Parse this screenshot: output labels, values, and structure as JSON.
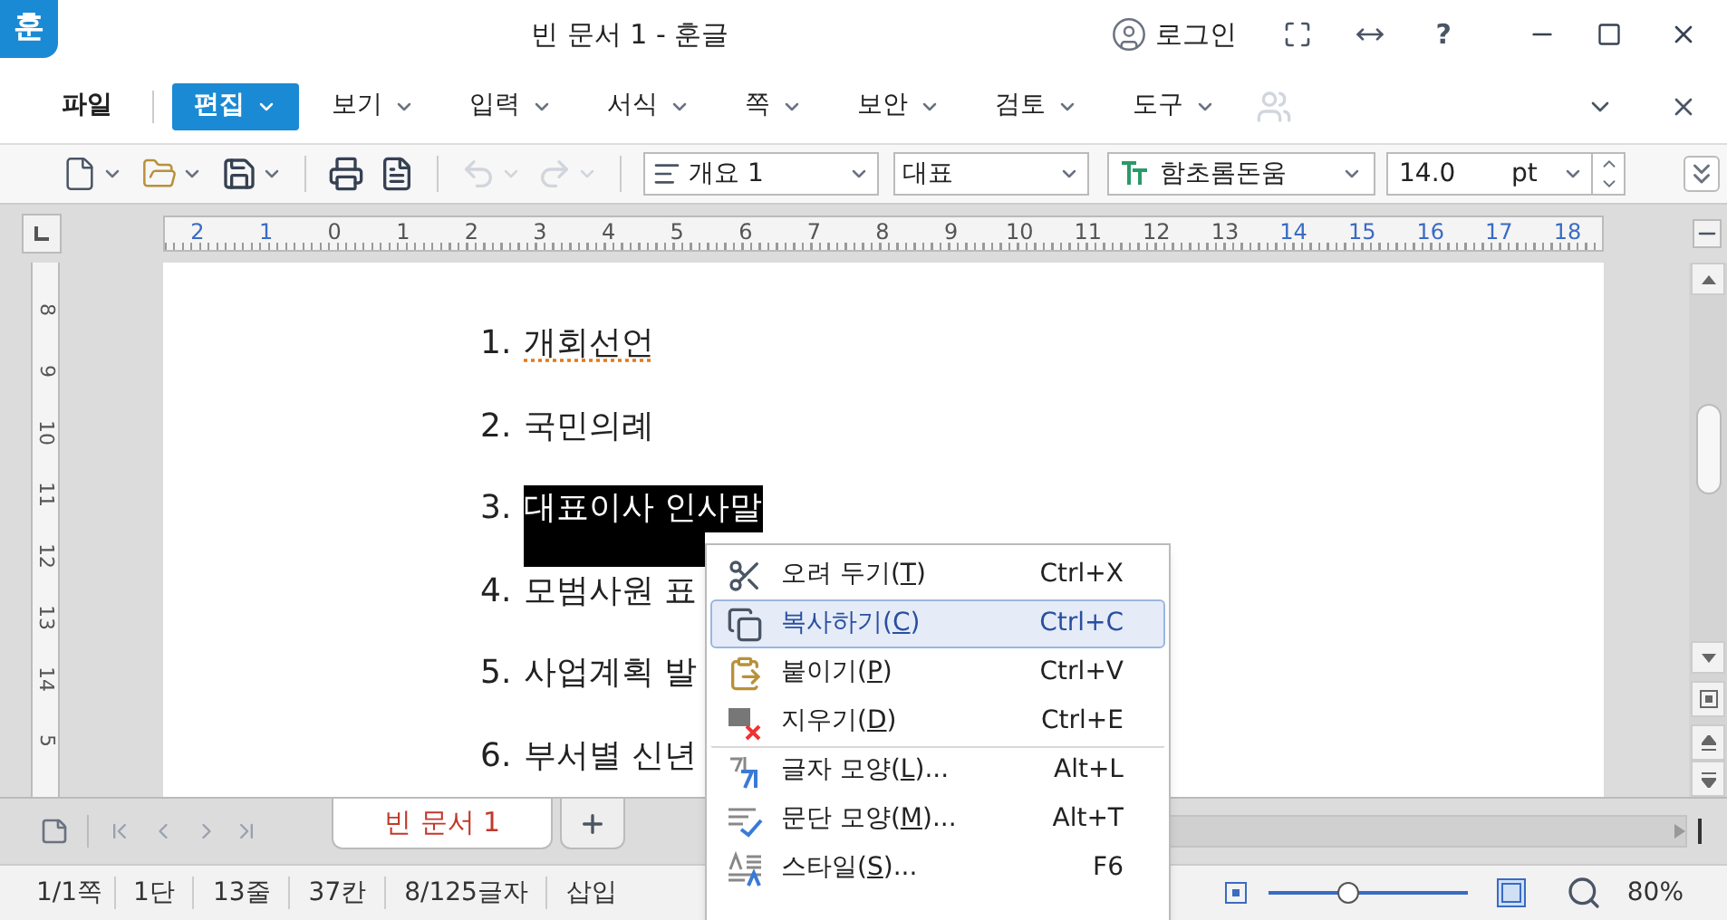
{
  "title_bar": {
    "logo": "훈",
    "title": "빈 문서 1 - 훈글",
    "login": "로그인",
    "help": "?"
  },
  "menu_bar": {
    "items": [
      {
        "label": "파일",
        "selected": false,
        "dropdown": false
      },
      {
        "label": "편집",
        "selected": true,
        "dropdown": true
      },
      {
        "label": "보기",
        "selected": false,
        "dropdown": true
      },
      {
        "label": "입력",
        "selected": false,
        "dropdown": true
      },
      {
        "label": "서식",
        "selected": false,
        "dropdown": true
      },
      {
        "label": "쪽",
        "selected": false,
        "dropdown": true
      },
      {
        "label": "보안",
        "selected": false,
        "dropdown": true
      },
      {
        "label": "검토",
        "selected": false,
        "dropdown": true
      },
      {
        "label": "도구",
        "selected": false,
        "dropdown": true
      }
    ]
  },
  "toolbar": {
    "undo_disabled": true,
    "redo_disabled": true,
    "style": "개요 1",
    "style_group": "대표",
    "font": "함초롬돈움",
    "size": "14.0",
    "unit": "pt"
  },
  "ruler": {
    "h_labels": [
      "2",
      "1",
      "0",
      "1",
      "2",
      "3",
      "4",
      "5",
      "6",
      "7",
      "8",
      "9",
      "10",
      "11",
      "12",
      "13",
      "14",
      "15",
      "16",
      "17",
      "18"
    ],
    "v_labels": [
      "8",
      "9",
      "10",
      "11",
      "12",
      "13",
      "14",
      "5"
    ]
  },
  "document": {
    "lines": [
      {
        "number": "1.",
        "text": "개회선언",
        "selected": false,
        "spell_error": true
      },
      {
        "number": "2.",
        "text": "국민의례",
        "selected": false,
        "spell_error": false
      },
      {
        "number": "3.",
        "text": "대표이사 인사말",
        "selected": true,
        "spell_error": false
      },
      {
        "number": "4.",
        "text": "모범사원 표",
        "selected": false,
        "spell_error": false
      },
      {
        "number": "5.",
        "text": "사업계획 발",
        "selected": false,
        "spell_error": false
      },
      {
        "number": "6.",
        "text": "부서별 신년",
        "selected": false,
        "spell_error": false
      }
    ]
  },
  "context_menu": {
    "items": [
      {
        "kind": "cut",
        "label": "오려 두기(",
        "key": "T",
        "label_end": ")",
        "shortcut": "Ctrl+X",
        "selected": false,
        "separator_before": false
      },
      {
        "kind": "copy",
        "label": "복사하기(",
        "key": "C",
        "label_end": ")",
        "shortcut": "Ctrl+C",
        "selected": true,
        "separator_before": false
      },
      {
        "kind": "paste",
        "label": "붙이기(",
        "key": "P",
        "label_end": ")",
        "shortcut": "Ctrl+V",
        "selected": false,
        "separator_before": false
      },
      {
        "kind": "delete",
        "label": "지우기(",
        "key": "D",
        "label_end": ")",
        "shortcut": "Ctrl+E",
        "selected": false,
        "separator_before": false
      },
      {
        "kind": "char",
        "label": "글자 모양(",
        "key": "L",
        "label_end": ")...",
        "shortcut": "Alt+L",
        "selected": false,
        "separator_before": true
      },
      {
        "kind": "para",
        "label": "문단 모양(",
        "key": "M",
        "label_end": ")...",
        "shortcut": "Alt+T",
        "selected": false,
        "separator_before": false
      },
      {
        "kind": "style",
        "label": "스타일(",
        "key": "S",
        "label_end": ")...",
        "shortcut": "F6",
        "selected": false,
        "separator_before": false
      }
    ]
  },
  "tabs": [
    {
      "label": "빈 문서 1",
      "selected": true
    }
  ],
  "status_bar": {
    "items": [
      "1/1쪽",
      "1단",
      "13줄",
      "37칸",
      "8/125글자",
      "삽입"
    ],
    "zoom": {
      "level": 0.4,
      "value": "80%"
    }
  }
}
